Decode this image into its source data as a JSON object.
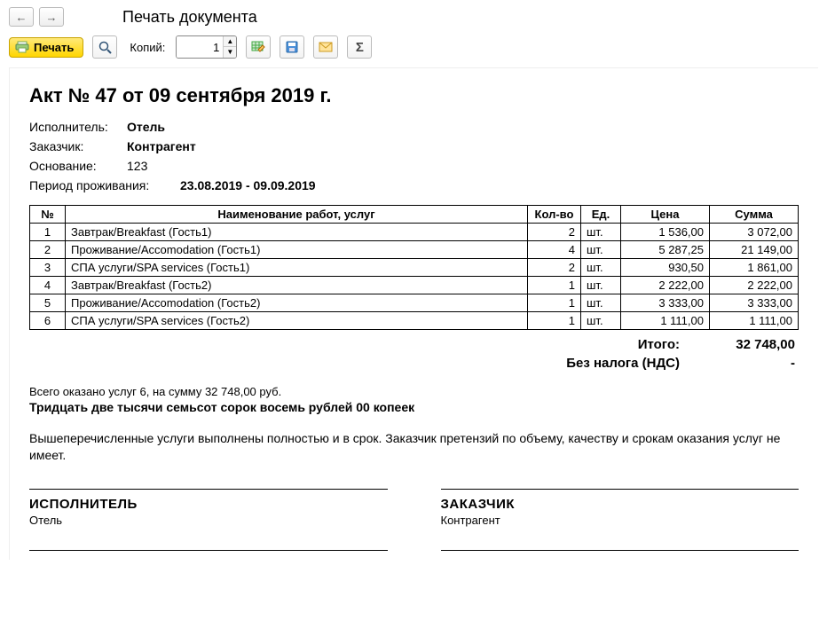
{
  "window": {
    "title": "Печать документа"
  },
  "toolbar": {
    "print_label": "Печать",
    "copies_label": "Копий:",
    "copies_value": "1"
  },
  "doc": {
    "title": "Акт № 47 от 09 сентября 2019 г.",
    "executor_label": "Исполнитель:",
    "executor_value": "Отель",
    "customer_label": "Заказчик:",
    "customer_value": "Контрагент",
    "basis_label": "Основание:",
    "basis_value": "123",
    "period_label": "Период проживания:",
    "period_value": "23.08.2019 - 09.09.2019"
  },
  "table": {
    "headers": {
      "num": "№",
      "name": "Наименование работ, услуг",
      "qty": "Кол-во",
      "unit": "Ед.",
      "price": "Цена",
      "sum": "Сумма"
    },
    "rows": [
      {
        "num": "1",
        "name": "Завтрак/Breakfast (Гость1)",
        "qty": "2",
        "unit": "шт.",
        "price": "1 536,00",
        "sum": "3 072,00"
      },
      {
        "num": "2",
        "name": "Проживание/Accomodation (Гость1)",
        "qty": "4",
        "unit": "шт.",
        "price": "5 287,25",
        "sum": "21 149,00"
      },
      {
        "num": "3",
        "name": "СПА услуги/SPA services (Гость1)",
        "qty": "2",
        "unit": "шт.",
        "price": "930,50",
        "sum": "1 861,00"
      },
      {
        "num": "4",
        "name": "Завтрак/Breakfast (Гость2)",
        "qty": "1",
        "unit": "шт.",
        "price": "2 222,00",
        "sum": "2 222,00"
      },
      {
        "num": "5",
        "name": "Проживание/Accomodation (Гость2)",
        "qty": "1",
        "unit": "шт.",
        "price": "3 333,00",
        "sum": "3 333,00"
      },
      {
        "num": "6",
        "name": "СПА услуги/SPA services (Гость2)",
        "qty": "1",
        "unit": "шт.",
        "price": "1 111,00",
        "sum": "1 111,00"
      }
    ]
  },
  "totals": {
    "total_label": "Итого:",
    "total_value": "32 748,00",
    "vat_label": "Без налога (НДС)",
    "vat_value": "-"
  },
  "summary": {
    "small": "Всего оказано услуг 6, на сумму 32 748,00 руб.",
    "words": "Тридцать две тысячи семьсот сорок восемь рублей 00 копеек",
    "disclaimer": "Вышеперечисленные услуги выполнены полностью и в срок. Заказчик претензий по объему, качеству и срокам оказания услуг не имеет."
  },
  "signatures": {
    "executor_title": "ИСПОЛНИТЕЛЬ",
    "executor_name": "Отель",
    "customer_title": "ЗАКАЗЧИК",
    "customer_name": "Контрагент"
  }
}
